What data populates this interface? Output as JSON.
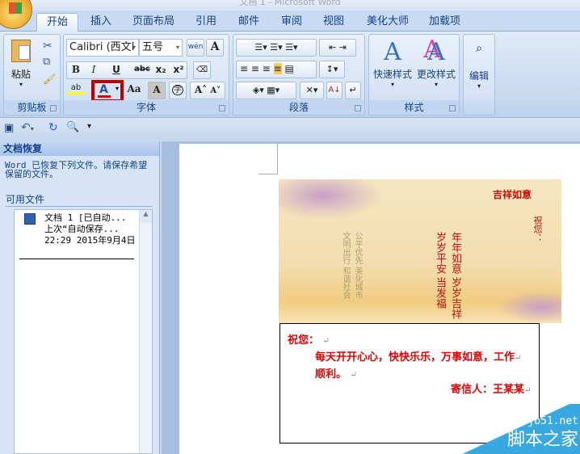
{
  "window": {
    "title": "文档 1 - Microsoft Word"
  },
  "tabs": [
    "开始",
    "插入",
    "页面布局",
    "引用",
    "邮件",
    "审阅",
    "视图",
    "美化大师",
    "加载项"
  ],
  "ribbon": {
    "clipboard": {
      "label": "剪贴板",
      "paste": "粘贴"
    },
    "font": {
      "label": "字体",
      "font_name": "Calibri (西文I",
      "font_size": "五号",
      "bold": "B",
      "italic": "I",
      "underline": "U",
      "strike": "abc",
      "sub": "x₂",
      "sup": "x²",
      "change_case": "Aa",
      "char_shade": "A",
      "enclose": "字",
      "grow": "A˄",
      "shrink": "A˅",
      "pinyin": "wén",
      "border_char": "A",
      "font_color": "A",
      "highlight": "ab"
    },
    "paragraph": {
      "label": "段落"
    },
    "styles": {
      "label": "样式",
      "quick": "快速样式",
      "change": "更改样式"
    },
    "editing": {
      "label": "编辑"
    }
  },
  "recovery": {
    "title": "文档恢复",
    "message": "Word 已恢复下列文件。请保存希望保留的文件。",
    "available": "可用文件",
    "file": {
      "name": "文档 1  [已自动...",
      "line2": "上次“自动保存...",
      "time": "22:29 2015年9月4日"
    }
  },
  "document": {
    "greeting": "祝您：",
    "line1": "每天开开心心，快快乐乐，万事如意，工作",
    "line2": "顺利。",
    "sender": "寄信人：王某某",
    "mark": "↵"
  },
  "picture": {
    "stamp": "吉祥如意",
    "wish": "祝您：",
    "c1": "年年如意",
    "c2": "岁岁平安",
    "c3": "岁岁吉祥",
    "c4": "当发福"
  },
  "watermark": {
    "site": "jb51.net",
    "name": "脚本之家"
  },
  "colors": {
    "accent": "#15428b",
    "text_red": "#e00000"
  }
}
